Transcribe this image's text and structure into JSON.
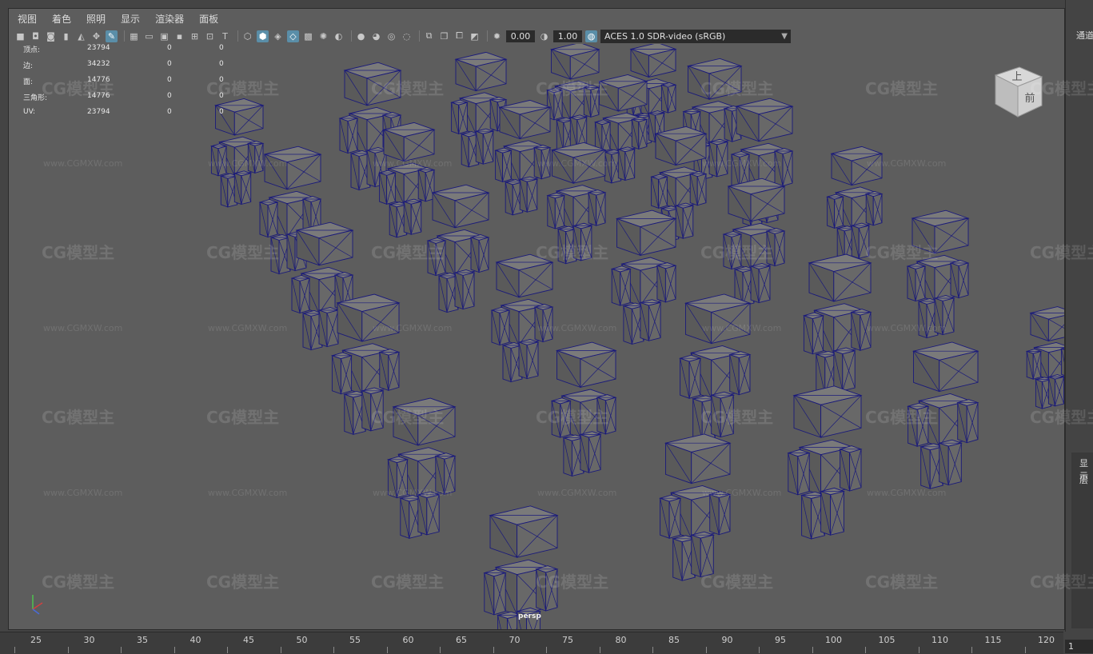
{
  "menu": [
    "视图",
    "着色",
    "照明",
    "显示",
    "渲染器",
    "面板"
  ],
  "toolbar": {
    "exposure_value": "0.00",
    "gamma_value": "1.00",
    "color_space": "ACES 1.0 SDR-video (sRGB)"
  },
  "hud": [
    {
      "label": "顶点:",
      "v1": "23794",
      "v2": "0",
      "v3": "0"
    },
    {
      "label": "边:",
      "v1": "34232",
      "v2": "0",
      "v3": "0"
    },
    {
      "label": "面:",
      "v1": "14776",
      "v2": "0",
      "v3": "0"
    },
    {
      "label": "三角形:",
      "v1": "14776",
      "v2": "0",
      "v3": "0"
    },
    {
      "label": "UV:",
      "v1": "23794",
      "v2": "0",
      "v3": "0"
    }
  ],
  "viewport": {
    "camera_label": "persp"
  },
  "viewcube": {
    "top_label": "上",
    "front_label": "前"
  },
  "right_panel": {
    "channel_label": "通道",
    "display_label": "显示",
    "layer_label": "层"
  },
  "timeline": {
    "ticks": [
      "25",
      "30",
      "35",
      "40",
      "45",
      "50",
      "55",
      "60",
      "65",
      "70",
      "75",
      "80",
      "85",
      "90",
      "95",
      "100",
      "105",
      "110",
      "115",
      "120"
    ],
    "current_frame": "1"
  },
  "watermark": {
    "brand": "CG模型主",
    "url": "www.CGMXW.com"
  },
  "colors": {
    "wireframe": "#1a1a7a",
    "viewport_bg": "#5d5d5d",
    "active_icon": "#5a8ea8"
  }
}
